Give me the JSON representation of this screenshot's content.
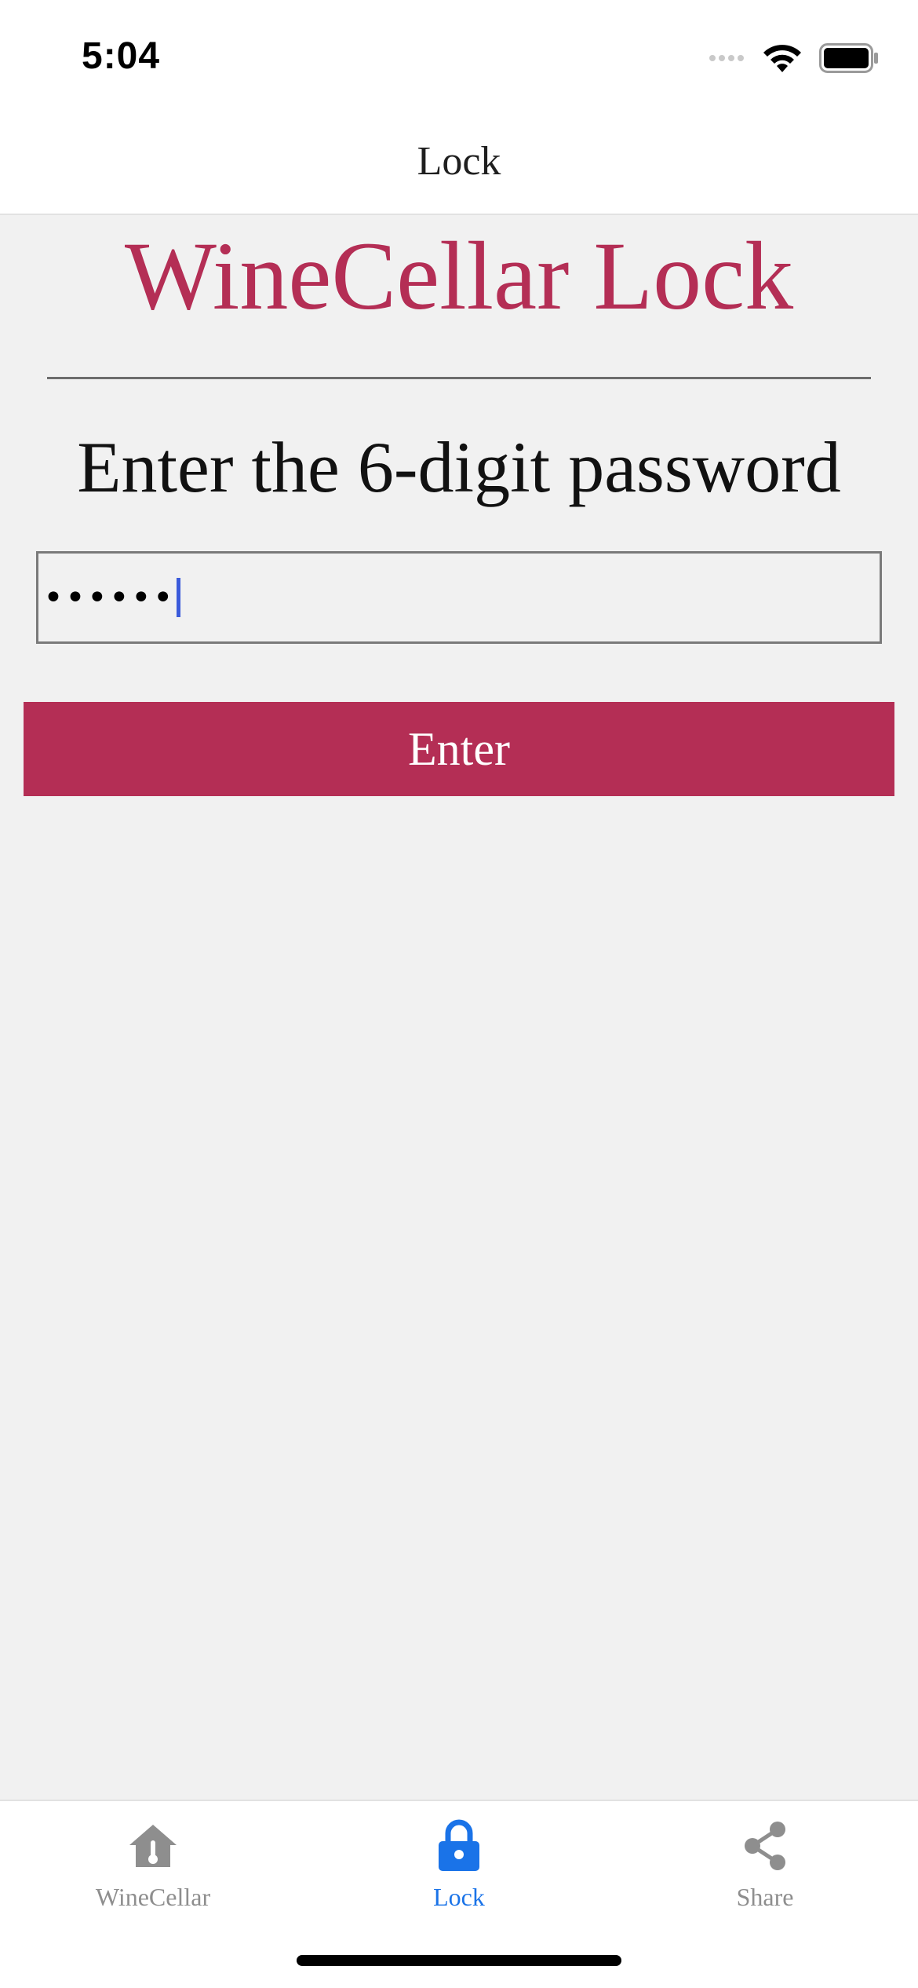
{
  "status_bar": {
    "time": "5:04"
  },
  "header": {
    "title": "Lock"
  },
  "main": {
    "heading": "WineCellar Lock",
    "prompt": "Enter the 6-digit password",
    "password_field": {
      "masked_value": "••••••"
    },
    "enter_button_label": "Enter"
  },
  "tabs": [
    {
      "label": "WineCellar",
      "icon": "house-thermometer-icon",
      "active": false
    },
    {
      "label": "Lock",
      "icon": "lock-icon",
      "active": true
    },
    {
      "label": "Share",
      "icon": "share-icon",
      "active": false
    }
  ],
  "colors": {
    "accent": "#b42e55",
    "tab_active": "#1a73e8",
    "tab_inactive": "#8e8e8e",
    "background": "#f1f1f1"
  }
}
